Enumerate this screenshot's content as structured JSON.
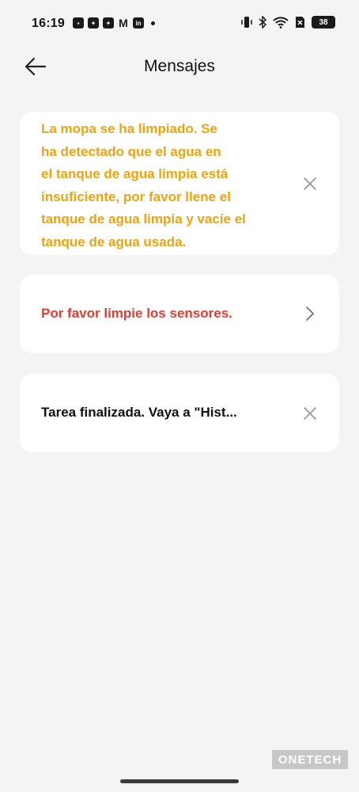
{
  "status_bar": {
    "time": "16:19",
    "notification_icons": [
      "app-icon",
      "app-icon",
      "app-icon",
      "gmail-icon",
      "linkedin-icon"
    ],
    "battery": "38"
  },
  "header": {
    "title": "Mensajes"
  },
  "messages": [
    {
      "text": "La mopa se ha limpiado. Se\nha detectado que el agua en\nel tanque de agua limpia está\ninsuficiente, por favor llene el\ntanque de agua limpia y vacíe el\ntanque de agua usada.",
      "color": "#f2a20d",
      "action": "close-icon"
    },
    {
      "text": "Por favor limpie los sensores.",
      "color": "#e23d34",
      "action": "chevron-right-icon"
    },
    {
      "text": "Tarea finalizada. Vaya a \"Hist...",
      "color": "#111111",
      "action": "close-icon"
    }
  ],
  "watermark": "ONETECH"
}
